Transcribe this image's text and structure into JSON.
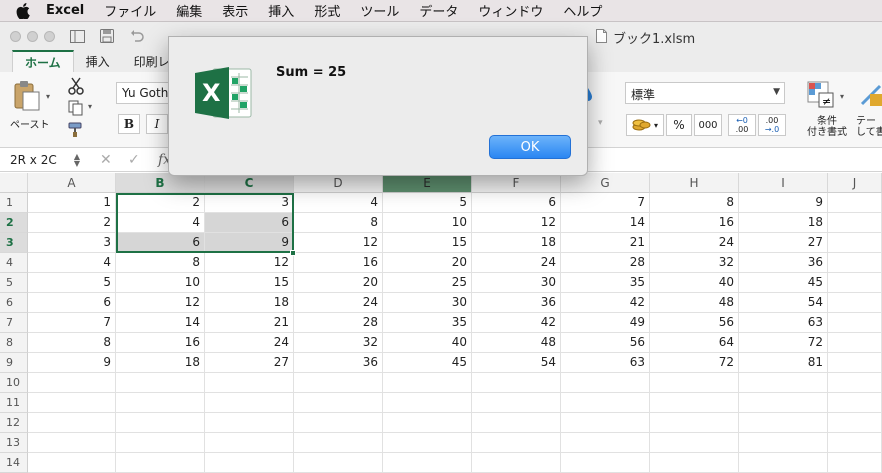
{
  "menubar": {
    "app_name": "Excel",
    "items": [
      "ファイル",
      "編集",
      "表示",
      "挿入",
      "形式",
      "ツール",
      "データ",
      "ウィンドウ",
      "ヘルプ"
    ]
  },
  "window": {
    "title": "ブック1.xlsm"
  },
  "ribbon": {
    "tabs": [
      "ホーム",
      "挿入",
      "印刷レ"
    ],
    "paste_label": "ペースト",
    "font_name": "Yu Gothi",
    "bold": "B",
    "italic": "I",
    "number_format": "標準",
    "percent": "%",
    "comma": "000",
    "dec_inc_top": "←0",
    "dec_inc_bottom": ".00",
    "dec_dec_top": ".00",
    "dec_dec_bottom": "→.0",
    "cond_format_label_1": "条件",
    "cond_format_label_2": "付き書式",
    "table_label_1": "テー",
    "table_label_2": "して書"
  },
  "formula_bar": {
    "name_box": "2R x 2C",
    "fx": "fx"
  },
  "sheet": {
    "columns": [
      "A",
      "B",
      "C",
      "D",
      "E",
      "F",
      "G",
      "H",
      "I",
      "J"
    ],
    "rows": [
      "1",
      "2",
      "3",
      "4",
      "5",
      "6",
      "7",
      "8",
      "9",
      "10",
      "11",
      "12",
      "13",
      "14"
    ],
    "values": [
      [
        "1",
        "2",
        "3",
        "4",
        "5",
        "6",
        "7",
        "8",
        "9"
      ],
      [
        "2",
        "4",
        "6",
        "8",
        "10",
        "12",
        "14",
        "16",
        "18"
      ],
      [
        "3",
        "6",
        "9",
        "12",
        "15",
        "18",
        "21",
        "24",
        "27"
      ],
      [
        "4",
        "8",
        "12",
        "16",
        "20",
        "24",
        "28",
        "32",
        "36"
      ],
      [
        "5",
        "10",
        "15",
        "20",
        "25",
        "30",
        "35",
        "40",
        "45"
      ],
      [
        "6",
        "12",
        "18",
        "24",
        "30",
        "36",
        "42",
        "48",
        "54"
      ],
      [
        "7",
        "14",
        "21",
        "28",
        "35",
        "42",
        "49",
        "56",
        "63"
      ],
      [
        "8",
        "16",
        "24",
        "32",
        "40",
        "48",
        "56",
        "64",
        "72"
      ],
      [
        "9",
        "18",
        "27",
        "36",
        "45",
        "54",
        "63",
        "72",
        "81"
      ]
    ]
  },
  "dialog": {
    "message": "Sum = 25",
    "ok_label": "OK",
    "icon_letter": "X"
  },
  "colors": {
    "excel_green": "#1e7145",
    "ok_blue": "#2a86f2"
  }
}
